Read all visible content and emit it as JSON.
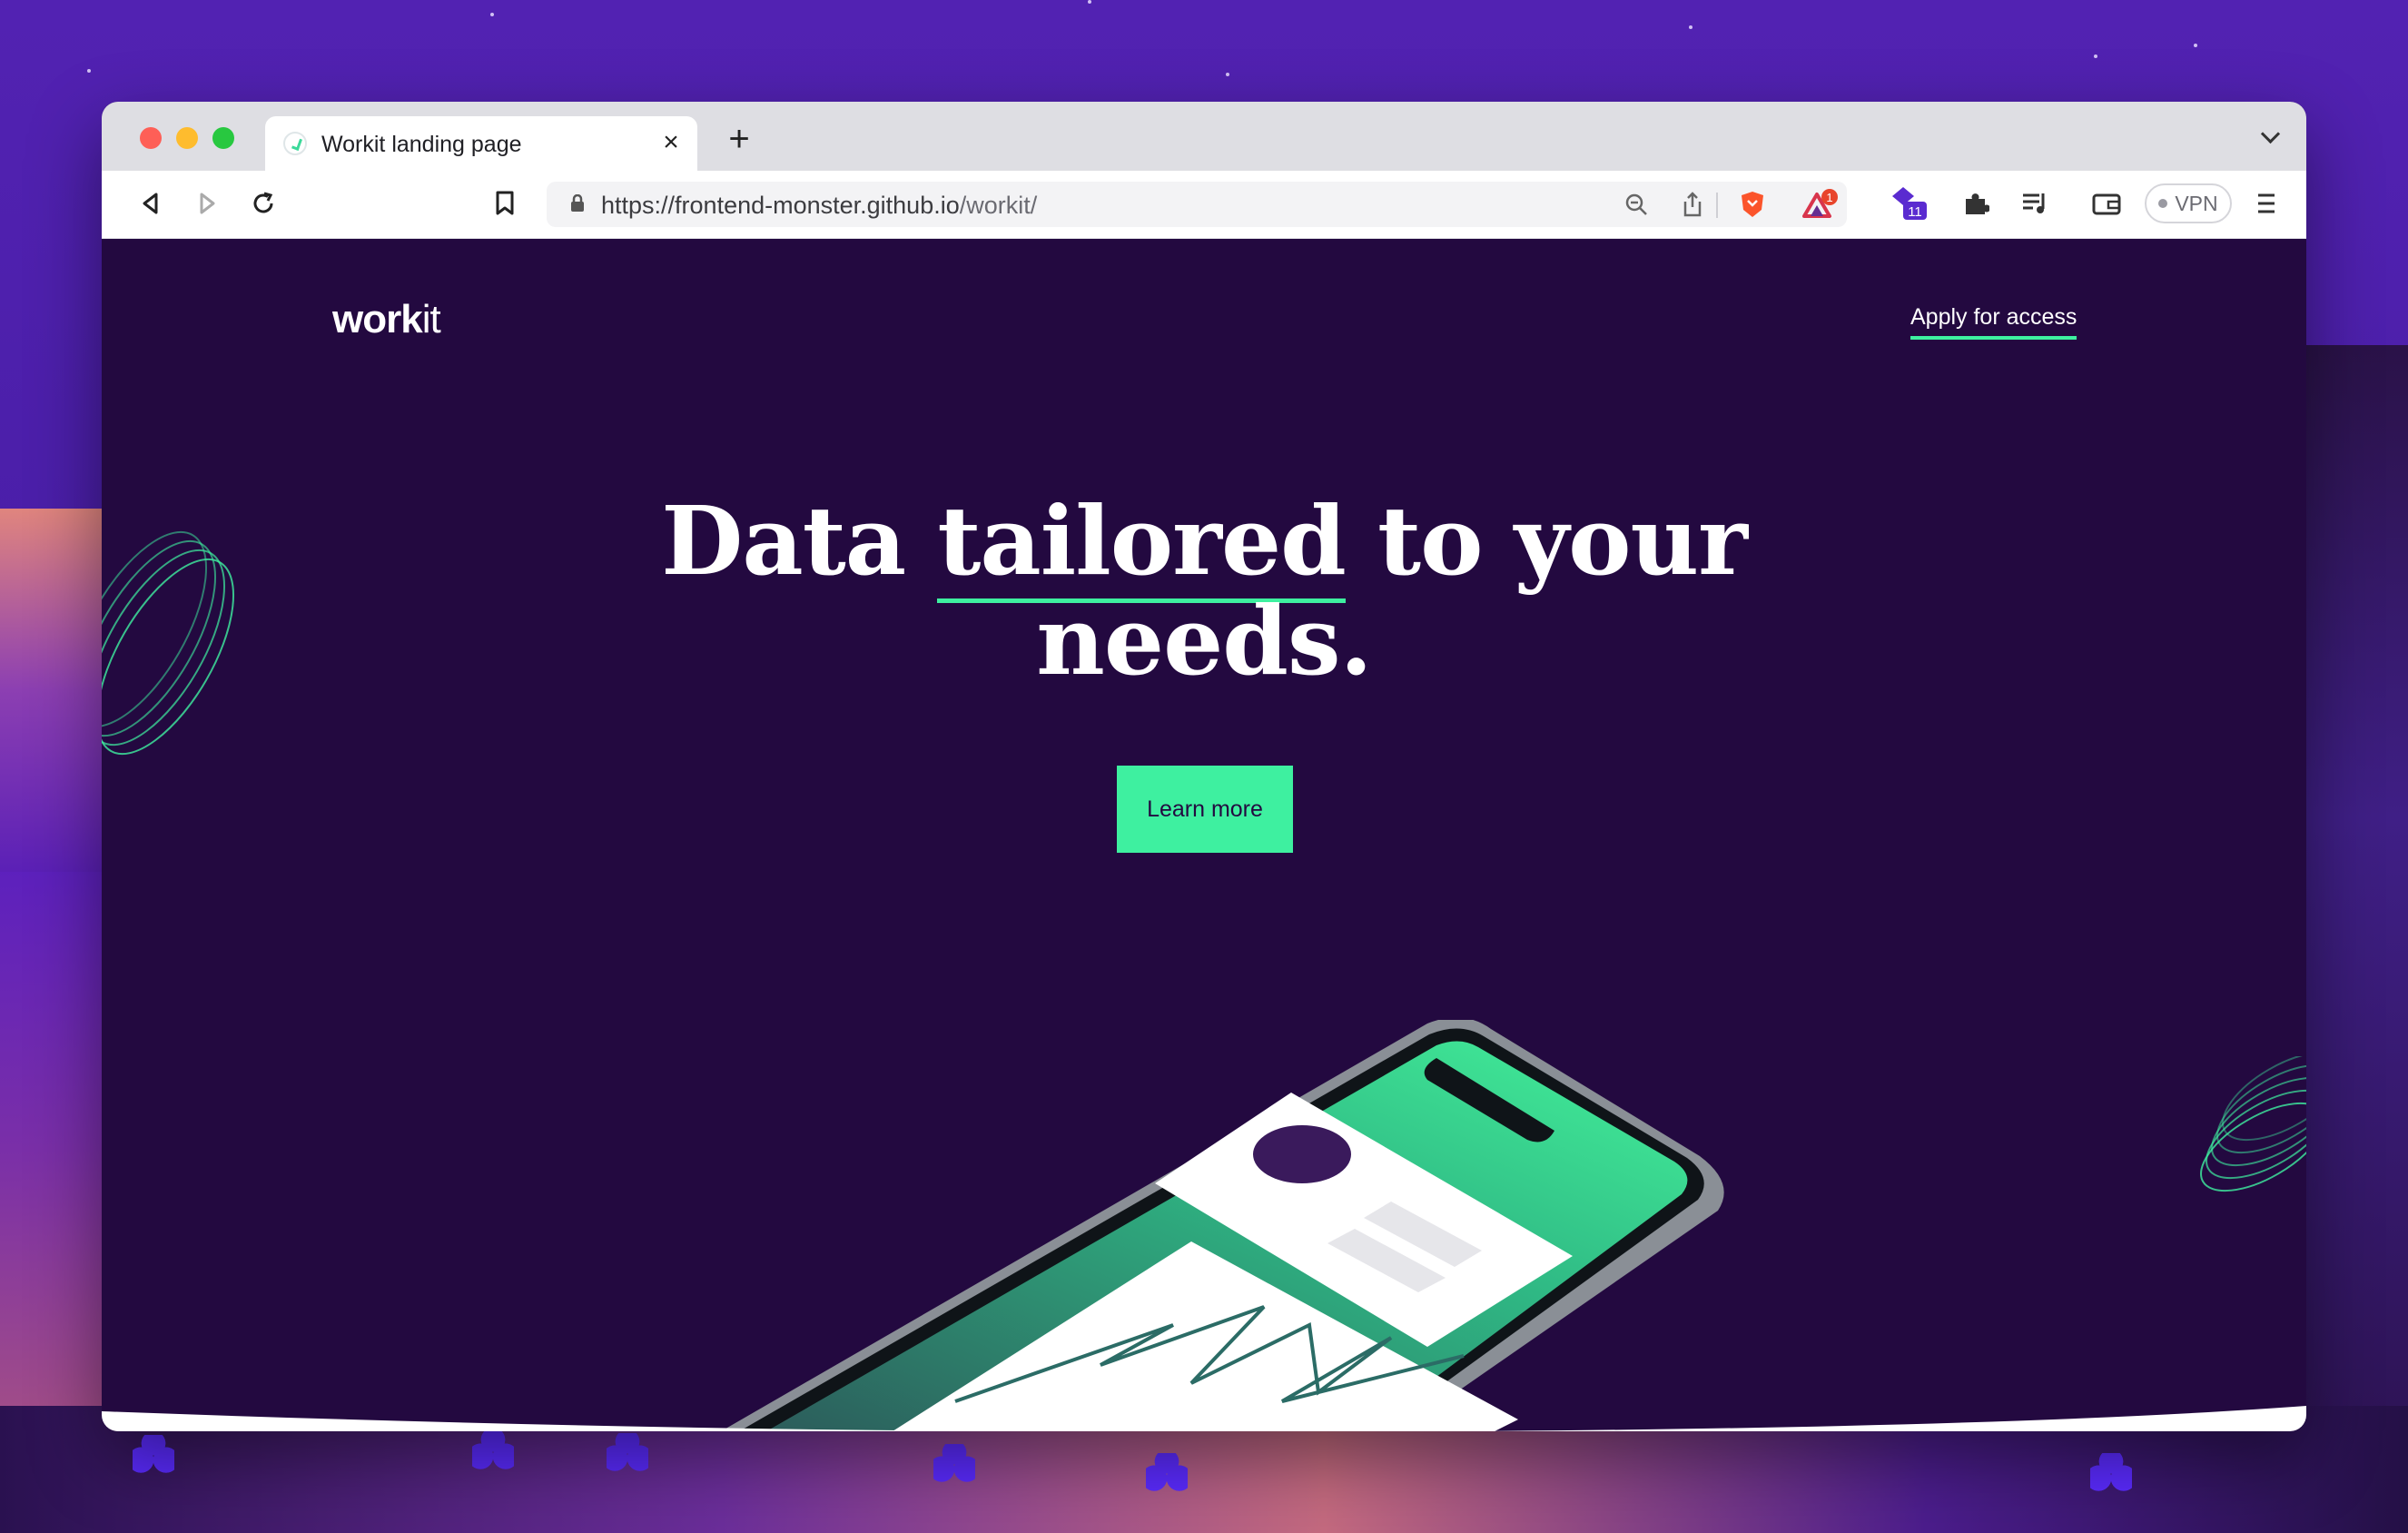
{
  "browser": {
    "tab_title": "Workit landing page",
    "url_base": "https://frontend-monster.github.io",
    "url_path": "/workit/",
    "vpn_label": "VPN",
    "rewards_badge": "1",
    "extension_badge": "11"
  },
  "page": {
    "logo_bold": "work",
    "logo_light": "it",
    "nav_link": "Apply for access",
    "headline_part1": "Data ",
    "headline_highlight": "tailored",
    "headline_part2": " to your",
    "headline_line2": "needs.",
    "cta_label": "Learn more"
  },
  "colors": {
    "background": "#230940",
    "accent": "#3ef0a0",
    "white": "#ffffff"
  },
  "icons": [
    "back-icon",
    "forward-icon",
    "reload-icon",
    "bookmark-icon",
    "lock-icon",
    "zoom-out-icon",
    "share-icon",
    "brave-shields-icon",
    "brave-rewards-icon",
    "extension-icon",
    "puzzle-icon",
    "playlist-icon",
    "wallet-icon",
    "menu-icon"
  ]
}
